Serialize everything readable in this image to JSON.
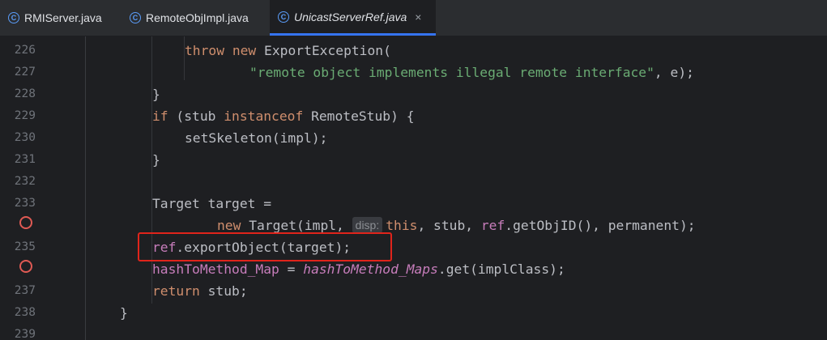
{
  "tabs": [
    {
      "label": "RMIServer.java",
      "icon": "java-class-icon",
      "active": false
    },
    {
      "label": "RemoteObjImpl.java",
      "icon": "java-class-icon",
      "active": false
    },
    {
      "label": "UnicastServerRef.java",
      "icon": "java-class-icon",
      "active": true,
      "close": "×"
    }
  ],
  "tab_icon_glyph": "C",
  "gutter": {
    "line_numbers": [
      "226",
      "227",
      "228",
      "229",
      "230",
      "231",
      "232",
      "233",
      "",
      "235",
      "",
      "237",
      "238",
      "239"
    ],
    "breakpoint_lines": [
      "234",
      "236"
    ],
    "breakpoint_color": "#e05a54"
  },
  "code": {
    "l226": {
      "kw1": "throw",
      "kw2": "new",
      "rest": " ExportException("
    },
    "l227": {
      "str": "\"remote object implements illegal remote interface\"",
      "rest": ", e);"
    },
    "l228": {
      "text": "}"
    },
    "l229": {
      "kw1": "if",
      "mid": " (stub ",
      "kw2": "instanceof",
      "rest": " RemoteStub) {"
    },
    "l230": {
      "text": "setSkeleton(impl);"
    },
    "l231": {
      "text": "}"
    },
    "l233": {
      "text": "Target target ="
    },
    "l234": {
      "kw": "new",
      "pre": " Target(impl, ",
      "hint": "disp:",
      "kw2": "this",
      "mid": ", stub, ",
      "fld": "ref",
      "rest": ".getObjID(), permanent);"
    },
    "l235": {
      "fld": "ref",
      "rest": ".exportObject(target);"
    },
    "l236": {
      "fld": "hashToMethod_Map",
      "mid": " = ",
      "stfld": "hashToMethod_Maps",
      "rest": ".get(implClass);"
    },
    "l237": {
      "kw": "return",
      "rest": " stub;"
    },
    "l238": {
      "text": "}"
    }
  },
  "colors": {
    "background": "#1e1f22",
    "keyword": "#cf8e6d",
    "string": "#6aab73",
    "field": "#c77dbb",
    "highlight_box": "#e0241b",
    "active_tab_underline": "#3574f0"
  }
}
